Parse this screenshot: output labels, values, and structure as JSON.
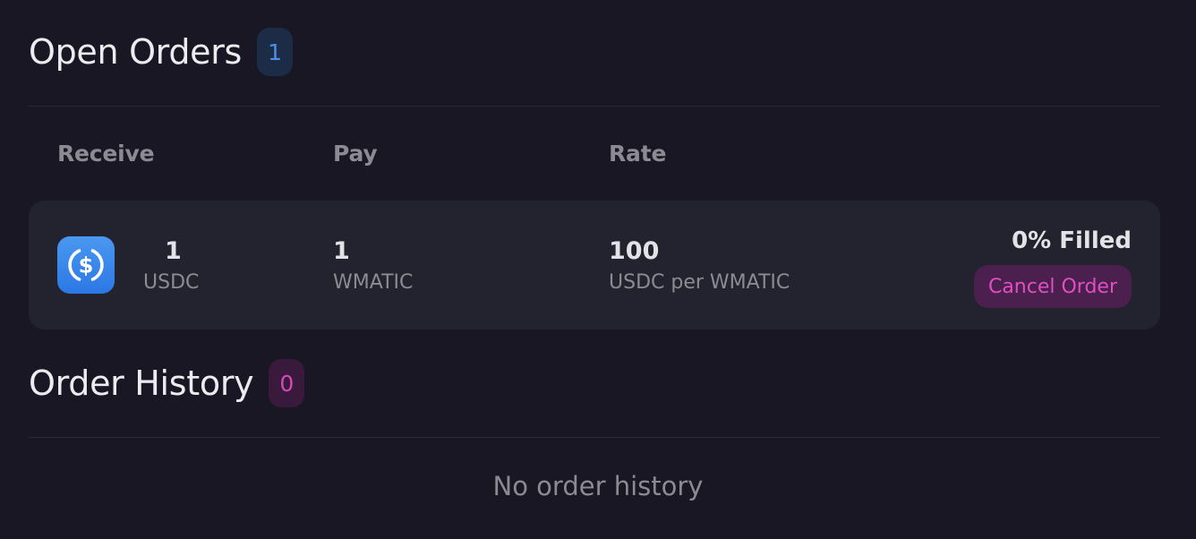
{
  "open_orders": {
    "title": "Open Orders",
    "count": "1",
    "columns": {
      "receive": "Receive",
      "pay": "Pay",
      "rate": "Rate"
    },
    "orders": [
      {
        "receive_icon": "usdc-icon",
        "receive_amount": "1",
        "receive_token": "USDC",
        "pay_amount": "1",
        "pay_token": "WMATIC",
        "rate_value": "100",
        "rate_unit": "USDC per WMATIC",
        "filled": "0% Filled",
        "cancel_label": "Cancel Order"
      }
    ]
  },
  "order_history": {
    "title": "Order History",
    "count": "0",
    "empty_message": "No order history"
  },
  "colors": {
    "background": "#181723",
    "card": "#22232f",
    "accent_blue": "#4f8ee6",
    "accent_pink": "#e04fc0"
  }
}
